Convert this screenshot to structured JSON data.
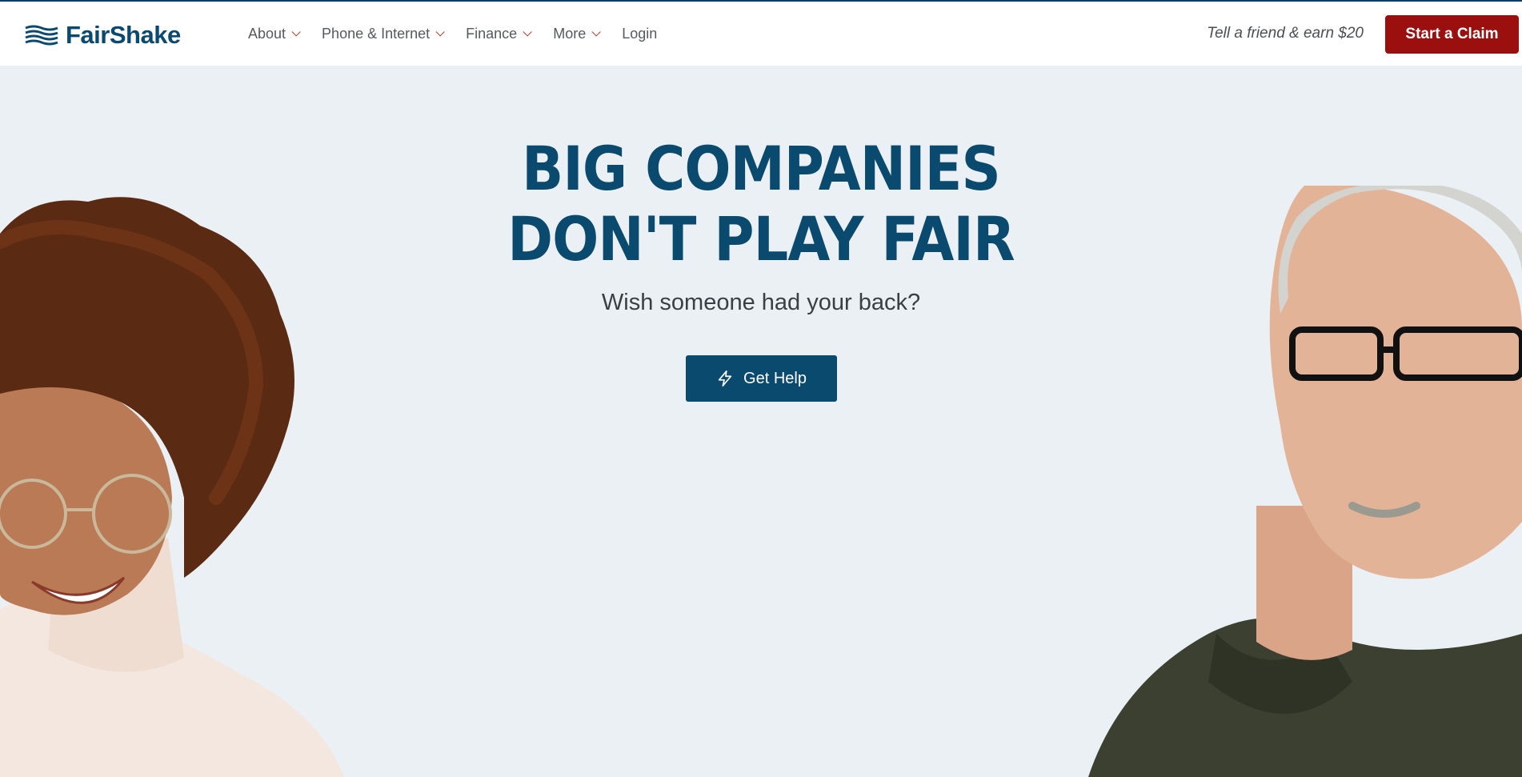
{
  "brand": {
    "name": "FairShake",
    "logo_icon": "wave-stripes-icon"
  },
  "nav": {
    "items": [
      {
        "label": "About",
        "has_dropdown": true
      },
      {
        "label": "Phone & Internet",
        "has_dropdown": true
      },
      {
        "label": "Finance",
        "has_dropdown": true
      },
      {
        "label": "More",
        "has_dropdown": true
      },
      {
        "label": "Login",
        "has_dropdown": false
      }
    ]
  },
  "header": {
    "refer_text": "Tell a friend & earn $20",
    "claim_button": "Start a Claim"
  },
  "hero": {
    "headline_line1": "BIG COMPANIES",
    "headline_line2": "DON'T PLAY FAIR",
    "subline": "Wish someone had your back?",
    "cta_label": "Get Help",
    "cta_icon": "lightning-icon",
    "left_image": "smiling-woman-with-curly-hair-and-glasses",
    "right_image": "older-man-with-glasses-in-green-polo"
  },
  "colors": {
    "brand_blue": "#0b4a6f",
    "claim_red": "#9c0f0f",
    "hero_bg": "#eaf0f3"
  }
}
